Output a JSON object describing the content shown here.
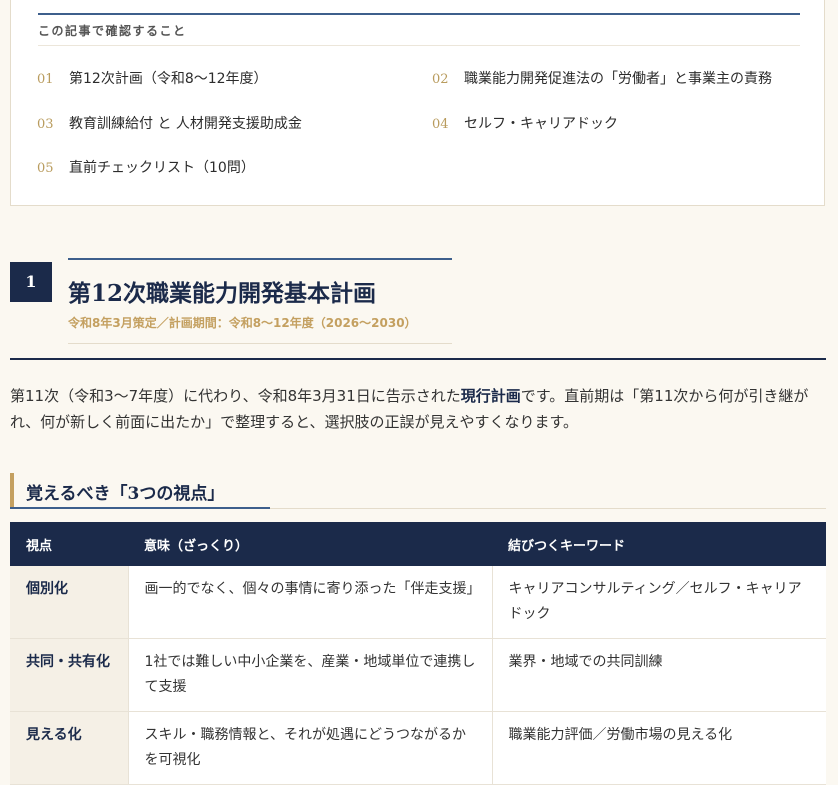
{
  "toc": {
    "heading": "この記事で確認すること",
    "items": [
      {
        "num": "01",
        "label": "第12次計画（令和8〜12年度）"
      },
      {
        "num": "02",
        "label": "職業能力開発促進法の「労働者」と事業主の責務"
      },
      {
        "num": "03",
        "label": "教育訓練給付 と 人材開発支援助成金"
      },
      {
        "num": "04",
        "label": "セルフ・キャリアドック"
      },
      {
        "num": "05",
        "label": "直前チェックリスト（10問）"
      }
    ]
  },
  "section": {
    "number": "1",
    "title": "第12次職業能力開発基本計画",
    "subtitle": "令和8年3月策定／計画期間：令和8〜12年度（2026〜2030）"
  },
  "intro": {
    "part1": "第11次（令和3〜7年度）に代わり、令和8年3月31日に告示された",
    "bold": "現行計画",
    "part2": "です。直前期は「第11次から何が引き継がれ、何が新しく前面に出たか」で整理すると、選択肢の正誤が見えやすくなります。"
  },
  "subheading": "覚えるべき「3つの視点」",
  "table": {
    "headers": [
      "視点",
      "意味（ざっくり）",
      "結びつくキーワード"
    ],
    "rows": [
      [
        "個別化",
        "画一的でなく、個々の事情に寄り添った「伴走支援」",
        "キャリアコンサルティング／セルフ・キャリアドック"
      ],
      [
        "共同・共有化",
        "1社では難しい中小企業を、産業・地域単位で連携して支援",
        "業界・地域での共同訓練"
      ],
      [
        "見える化",
        "スキル・職務情報と、それが処遇にどうつながるかを可視化",
        "職業能力評価／労働市場の見える化"
      ]
    ]
  }
}
